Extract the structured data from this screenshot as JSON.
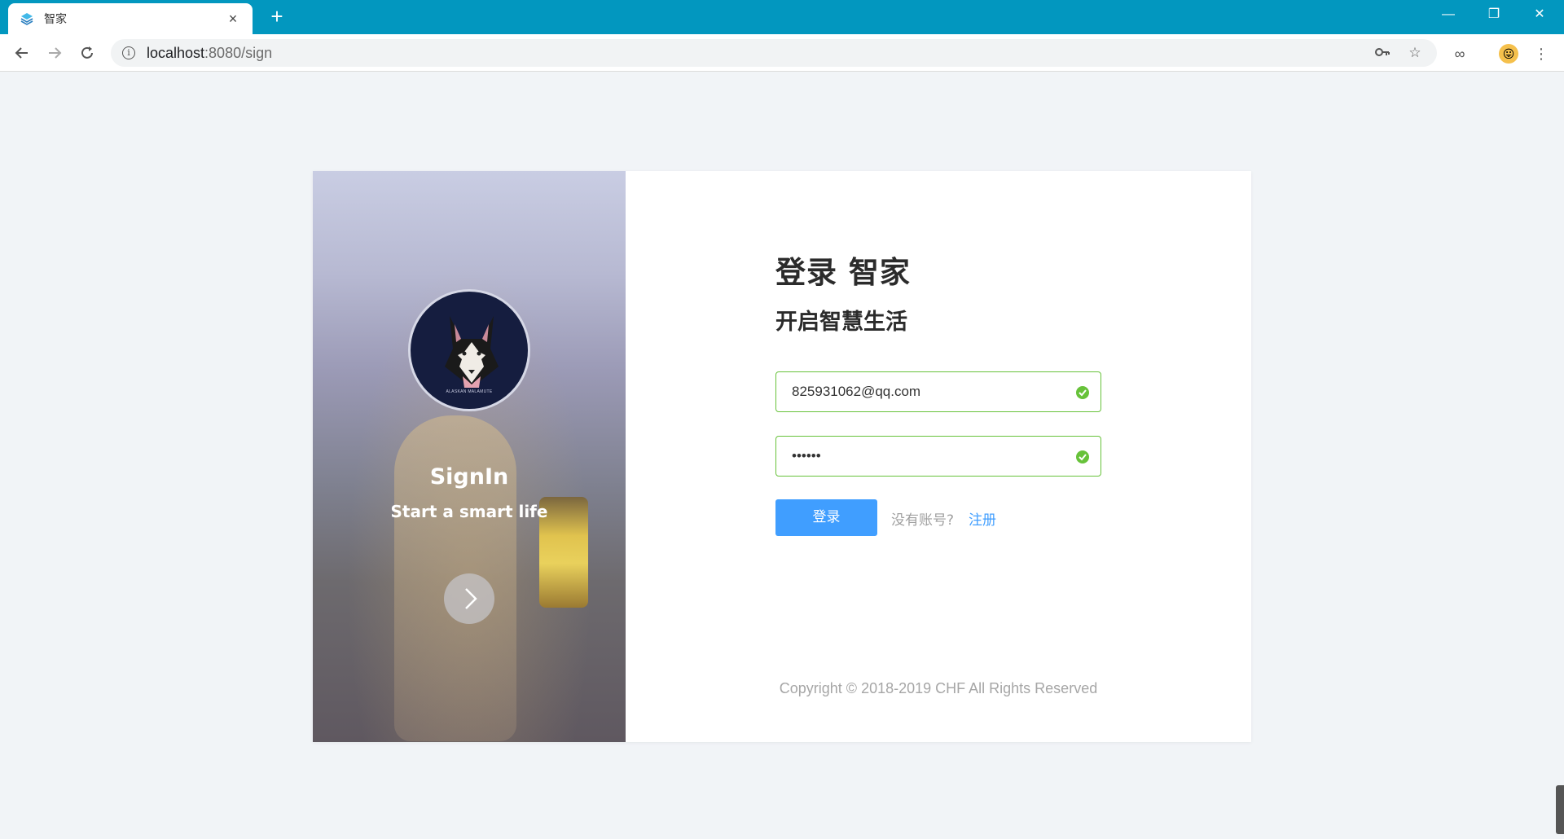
{
  "browser": {
    "tab_title": "智家",
    "url_host": "localhost",
    "url_path": ":8080/sign",
    "new_tab_label": "+",
    "tab_close_label": "×",
    "minimize_label": "—",
    "restore_label": "❐",
    "close_label": "✕"
  },
  "left_panel": {
    "title": "SignIn",
    "subtitle": "Start a smart life",
    "avatar_caption": "ALASKAN MALAMUTE"
  },
  "form": {
    "heading": "登录 智家",
    "subheading": "开启智慧生活",
    "email_value": "825931062@qq.com",
    "password_value": "••••••",
    "login_button": "登录",
    "no_account_text": "没有账号?",
    "register_link": "注册"
  },
  "footer": {
    "copyright": "Copyright © 2018-2019 CHF All Rights Reserved"
  },
  "colors": {
    "titlebar": "#0297bf",
    "primary": "#409eff",
    "success": "#67c23a",
    "page_bg": "#f1f4f7"
  }
}
